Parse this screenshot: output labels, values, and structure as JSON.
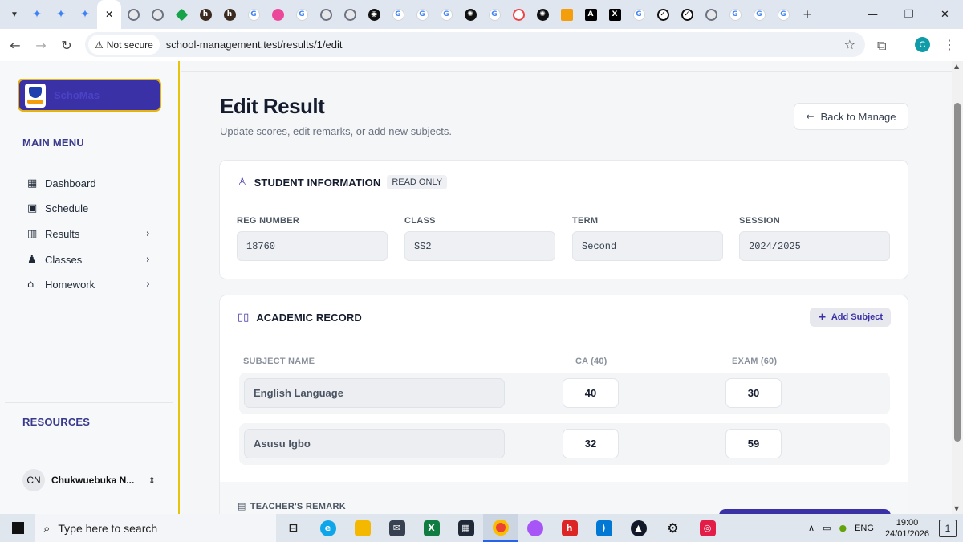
{
  "browser": {
    "tabs": [
      {
        "icon": "gemini-icon"
      },
      {
        "icon": "gemini-icon"
      },
      {
        "icon": "gemini-icon"
      },
      {
        "icon": "active-tab",
        "active": true
      },
      {
        "icon": "globe-icon"
      },
      {
        "icon": "globe-icon"
      },
      {
        "icon": "diamond-icon"
      },
      {
        "icon": "dark-app-icon"
      },
      {
        "icon": "dark-app-icon"
      },
      {
        "icon": "google-icon"
      },
      {
        "icon": "dribbble-icon"
      },
      {
        "icon": "google-icon"
      },
      {
        "icon": "globe-icon"
      },
      {
        "icon": "globe-icon"
      },
      {
        "icon": "github-icon"
      },
      {
        "icon": "google-icon"
      },
      {
        "icon": "google-icon"
      },
      {
        "icon": "google-icon"
      },
      {
        "icon": "openai-icon"
      },
      {
        "icon": "google-icon"
      },
      {
        "icon": "target-icon"
      },
      {
        "icon": "openai-icon"
      },
      {
        "icon": "book-icon"
      },
      {
        "icon": "artifact-icon"
      },
      {
        "icon": "x-icon"
      },
      {
        "icon": "google-icon"
      },
      {
        "icon": "check-icon"
      },
      {
        "icon": "check-icon"
      },
      {
        "icon": "globe-icon"
      },
      {
        "icon": "google-icon"
      },
      {
        "icon": "google-icon"
      },
      {
        "icon": "google-icon"
      }
    ],
    "security_label": "Not secure",
    "url": "school-management.test/results/1/edit",
    "profile_initial": "C"
  },
  "sidebar": {
    "brand": "SchoMas",
    "main_menu_label": "MAIN MENU",
    "items": [
      {
        "label": "Dashboard",
        "icon": "grid-icon",
        "has_children": false
      },
      {
        "label": "Schedule",
        "icon": "calendar-icon",
        "has_children": false
      },
      {
        "label": "Results",
        "icon": "bar-chart-icon",
        "has_children": true
      },
      {
        "label": "Classes",
        "icon": "users-icon",
        "has_children": true
      },
      {
        "label": "Homework",
        "icon": "home-icon",
        "has_children": true
      }
    ],
    "resources_label": "RESOURCES",
    "user": {
      "initials": "CN",
      "name": "Chukwuebuka N..."
    }
  },
  "page": {
    "title": "Edit Result",
    "subtitle": "Update scores, edit remarks, or add new subjects.",
    "back_label": "Back to Manage"
  },
  "student_info": {
    "title": "STUDENT INFORMATION",
    "badge": "READ ONLY",
    "fields": [
      {
        "label": "REG NUMBER",
        "value": "18760"
      },
      {
        "label": "CLASS",
        "value": "SS2"
      },
      {
        "label": "TERM",
        "value": "Second"
      },
      {
        "label": "SESSION",
        "value": "2024/2025"
      }
    ]
  },
  "academic": {
    "title": "ACADEMIC RECORD",
    "add_label": "Add Subject",
    "columns": [
      "SUBJECT NAME",
      "CA (40)",
      "EXAM (60)"
    ],
    "rows": [
      {
        "subject": "English Language",
        "ca": "40",
        "exam": "30"
      },
      {
        "subject": "Asusu Igbo",
        "ca": "32",
        "exam": "59"
      }
    ],
    "remark_label": "TEACHER'S REMARK"
  },
  "taskbar": {
    "search_placeholder": "Type here to search",
    "language": "ENG",
    "time": "19:00",
    "date": "24/01/2026",
    "notification_count": "1"
  }
}
